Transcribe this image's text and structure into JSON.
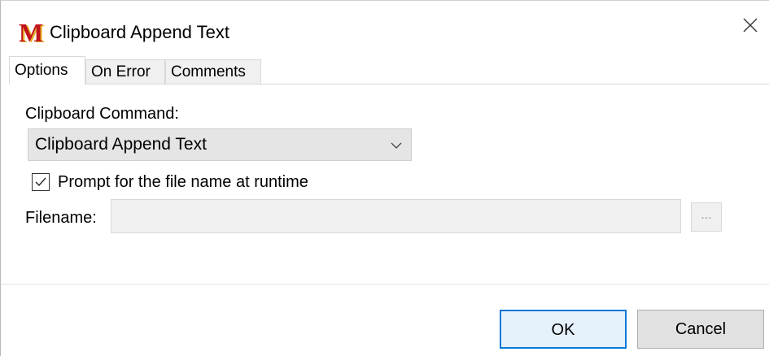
{
  "window": {
    "title": "Clipboard Append Text",
    "app_icon_letter": "M",
    "icons": {
      "close": "close-icon",
      "app": "app-logo-icon"
    }
  },
  "tabs": [
    {
      "label": "Options",
      "active": true
    },
    {
      "label": "On Error",
      "active": false
    },
    {
      "label": "Comments",
      "active": false
    }
  ],
  "options": {
    "command_label": "Clipboard Command:",
    "command_value": "Clipboard Append Text",
    "prompt_checkbox_label": "Prompt for the file name at runtime",
    "prompt_checked": true,
    "filename_label": "Filename:",
    "filename_value": "",
    "browse_label": "..."
  },
  "buttons": {
    "ok": "OK",
    "cancel": "Cancel"
  },
  "colors": {
    "accent": "#0078d7",
    "logo_red": "#c0141b",
    "logo_gold": "#e7b020"
  }
}
